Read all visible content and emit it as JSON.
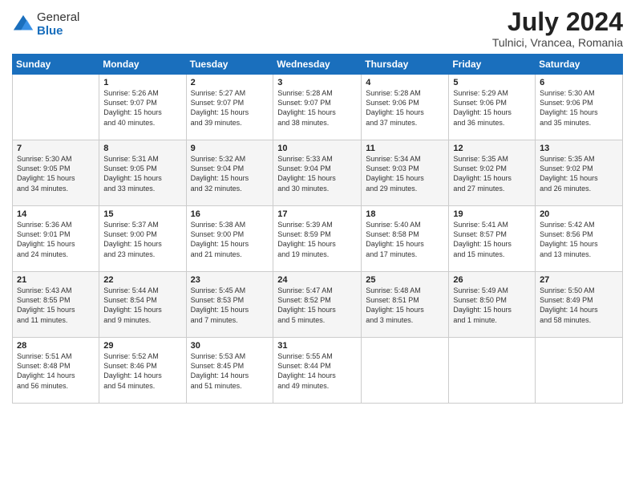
{
  "header": {
    "logo_general": "General",
    "logo_blue": "Blue",
    "month_year": "July 2024",
    "location": "Tulnici, Vrancea, Romania"
  },
  "calendar": {
    "headers": [
      "Sunday",
      "Monday",
      "Tuesday",
      "Wednesday",
      "Thursday",
      "Friday",
      "Saturday"
    ],
    "rows": [
      [
        {
          "num": "",
          "text": ""
        },
        {
          "num": "1",
          "text": "Sunrise: 5:26 AM\nSunset: 9:07 PM\nDaylight: 15 hours\nand 40 minutes."
        },
        {
          "num": "2",
          "text": "Sunrise: 5:27 AM\nSunset: 9:07 PM\nDaylight: 15 hours\nand 39 minutes."
        },
        {
          "num": "3",
          "text": "Sunrise: 5:28 AM\nSunset: 9:07 PM\nDaylight: 15 hours\nand 38 minutes."
        },
        {
          "num": "4",
          "text": "Sunrise: 5:28 AM\nSunset: 9:06 PM\nDaylight: 15 hours\nand 37 minutes."
        },
        {
          "num": "5",
          "text": "Sunrise: 5:29 AM\nSunset: 9:06 PM\nDaylight: 15 hours\nand 36 minutes."
        },
        {
          "num": "6",
          "text": "Sunrise: 5:30 AM\nSunset: 9:06 PM\nDaylight: 15 hours\nand 35 minutes."
        }
      ],
      [
        {
          "num": "7",
          "text": "Sunrise: 5:30 AM\nSunset: 9:05 PM\nDaylight: 15 hours\nand 34 minutes."
        },
        {
          "num": "8",
          "text": "Sunrise: 5:31 AM\nSunset: 9:05 PM\nDaylight: 15 hours\nand 33 minutes."
        },
        {
          "num": "9",
          "text": "Sunrise: 5:32 AM\nSunset: 9:04 PM\nDaylight: 15 hours\nand 32 minutes."
        },
        {
          "num": "10",
          "text": "Sunrise: 5:33 AM\nSunset: 9:04 PM\nDaylight: 15 hours\nand 30 minutes."
        },
        {
          "num": "11",
          "text": "Sunrise: 5:34 AM\nSunset: 9:03 PM\nDaylight: 15 hours\nand 29 minutes."
        },
        {
          "num": "12",
          "text": "Sunrise: 5:35 AM\nSunset: 9:02 PM\nDaylight: 15 hours\nand 27 minutes."
        },
        {
          "num": "13",
          "text": "Sunrise: 5:35 AM\nSunset: 9:02 PM\nDaylight: 15 hours\nand 26 minutes."
        }
      ],
      [
        {
          "num": "14",
          "text": "Sunrise: 5:36 AM\nSunset: 9:01 PM\nDaylight: 15 hours\nand 24 minutes."
        },
        {
          "num": "15",
          "text": "Sunrise: 5:37 AM\nSunset: 9:00 PM\nDaylight: 15 hours\nand 23 minutes."
        },
        {
          "num": "16",
          "text": "Sunrise: 5:38 AM\nSunset: 9:00 PM\nDaylight: 15 hours\nand 21 minutes."
        },
        {
          "num": "17",
          "text": "Sunrise: 5:39 AM\nSunset: 8:59 PM\nDaylight: 15 hours\nand 19 minutes."
        },
        {
          "num": "18",
          "text": "Sunrise: 5:40 AM\nSunset: 8:58 PM\nDaylight: 15 hours\nand 17 minutes."
        },
        {
          "num": "19",
          "text": "Sunrise: 5:41 AM\nSunset: 8:57 PM\nDaylight: 15 hours\nand 15 minutes."
        },
        {
          "num": "20",
          "text": "Sunrise: 5:42 AM\nSunset: 8:56 PM\nDaylight: 15 hours\nand 13 minutes."
        }
      ],
      [
        {
          "num": "21",
          "text": "Sunrise: 5:43 AM\nSunset: 8:55 PM\nDaylight: 15 hours\nand 11 minutes."
        },
        {
          "num": "22",
          "text": "Sunrise: 5:44 AM\nSunset: 8:54 PM\nDaylight: 15 hours\nand 9 minutes."
        },
        {
          "num": "23",
          "text": "Sunrise: 5:45 AM\nSunset: 8:53 PM\nDaylight: 15 hours\nand 7 minutes."
        },
        {
          "num": "24",
          "text": "Sunrise: 5:47 AM\nSunset: 8:52 PM\nDaylight: 15 hours\nand 5 minutes."
        },
        {
          "num": "25",
          "text": "Sunrise: 5:48 AM\nSunset: 8:51 PM\nDaylight: 15 hours\nand 3 minutes."
        },
        {
          "num": "26",
          "text": "Sunrise: 5:49 AM\nSunset: 8:50 PM\nDaylight: 15 hours\nand 1 minute."
        },
        {
          "num": "27",
          "text": "Sunrise: 5:50 AM\nSunset: 8:49 PM\nDaylight: 14 hours\nand 58 minutes."
        }
      ],
      [
        {
          "num": "28",
          "text": "Sunrise: 5:51 AM\nSunset: 8:48 PM\nDaylight: 14 hours\nand 56 minutes."
        },
        {
          "num": "29",
          "text": "Sunrise: 5:52 AM\nSunset: 8:46 PM\nDaylight: 14 hours\nand 54 minutes."
        },
        {
          "num": "30",
          "text": "Sunrise: 5:53 AM\nSunset: 8:45 PM\nDaylight: 14 hours\nand 51 minutes."
        },
        {
          "num": "31",
          "text": "Sunrise: 5:55 AM\nSunset: 8:44 PM\nDaylight: 14 hours\nand 49 minutes."
        },
        {
          "num": "",
          "text": ""
        },
        {
          "num": "",
          "text": ""
        },
        {
          "num": "",
          "text": ""
        }
      ]
    ]
  }
}
